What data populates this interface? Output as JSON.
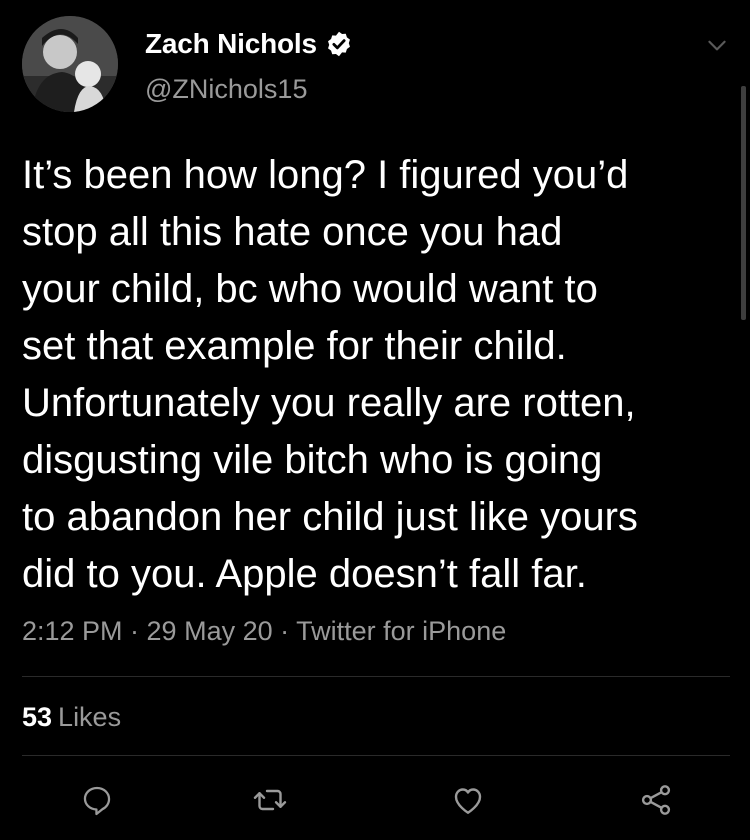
{
  "author": {
    "display_name": "Zach Nichols",
    "handle": "@ZNichols15",
    "verified": true
  },
  "tweet": {
    "lines": [
      "It’s been how long? I figured you’d",
      "stop all this hate once you had",
      "your child, bc who would want to",
      "set that example for their child.",
      "Unfortunately you really are rotten,",
      "disgusting vile bitch who is going",
      "to abandon her child just like yours",
      "did to you. Apple doesn’t fall far."
    ],
    "meta": "2:12 PM · 29 May 20 · Twitter for iPhone"
  },
  "stats": {
    "likes_count": "53",
    "likes_label": "Likes"
  },
  "icons": {
    "more": "chevron-down-icon",
    "verified": "verified-badge-icon",
    "reply": "reply-icon",
    "retweet": "retweet-icon",
    "like": "heart-icon",
    "share": "share-icon"
  },
  "colors": {
    "background": "#000000",
    "text": "#ffffff",
    "secondary_text": "#9a9a9a",
    "divider": "#2a2a2a",
    "icon": "#9a9a9a"
  }
}
